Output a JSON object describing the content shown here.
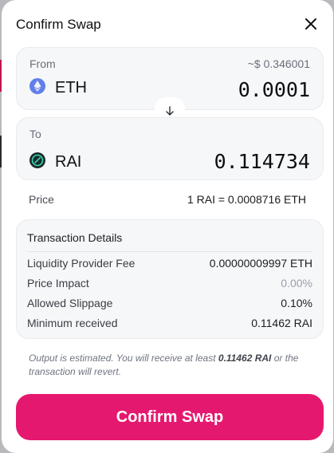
{
  "modal": {
    "title": "Confirm Swap"
  },
  "from": {
    "label": "From",
    "usd_value": "~$ 0.346001",
    "token_symbol": "ETH",
    "token_icon": "ethereum-icon",
    "amount": "0.0001"
  },
  "to": {
    "label": "To",
    "token_symbol": "RAI",
    "token_icon": "rai-icon",
    "amount": "0.114734"
  },
  "price": {
    "label": "Price",
    "value": "1 RAI = 0.0008716 ETH"
  },
  "details": {
    "title": "Transaction Details",
    "rows": [
      {
        "key": "Liquidity Provider Fee",
        "value": "0.00000009997 ETH"
      },
      {
        "key": "Price Impact",
        "value": "0.00%"
      },
      {
        "key": "Allowed Slippage",
        "value": "0.10%"
      },
      {
        "key": "Minimum received",
        "value": "0.11462 RAI"
      }
    ]
  },
  "note": {
    "prefix": "Output is estimated. You will receive at least ",
    "amount": "0.11462 RAI",
    "suffix": " or the transaction will revert."
  },
  "confirm_button": {
    "label": "Confirm Swap"
  },
  "colors": {
    "accent": "#e5186f",
    "eth": "#627eea",
    "rai": "#1b2a2a"
  }
}
